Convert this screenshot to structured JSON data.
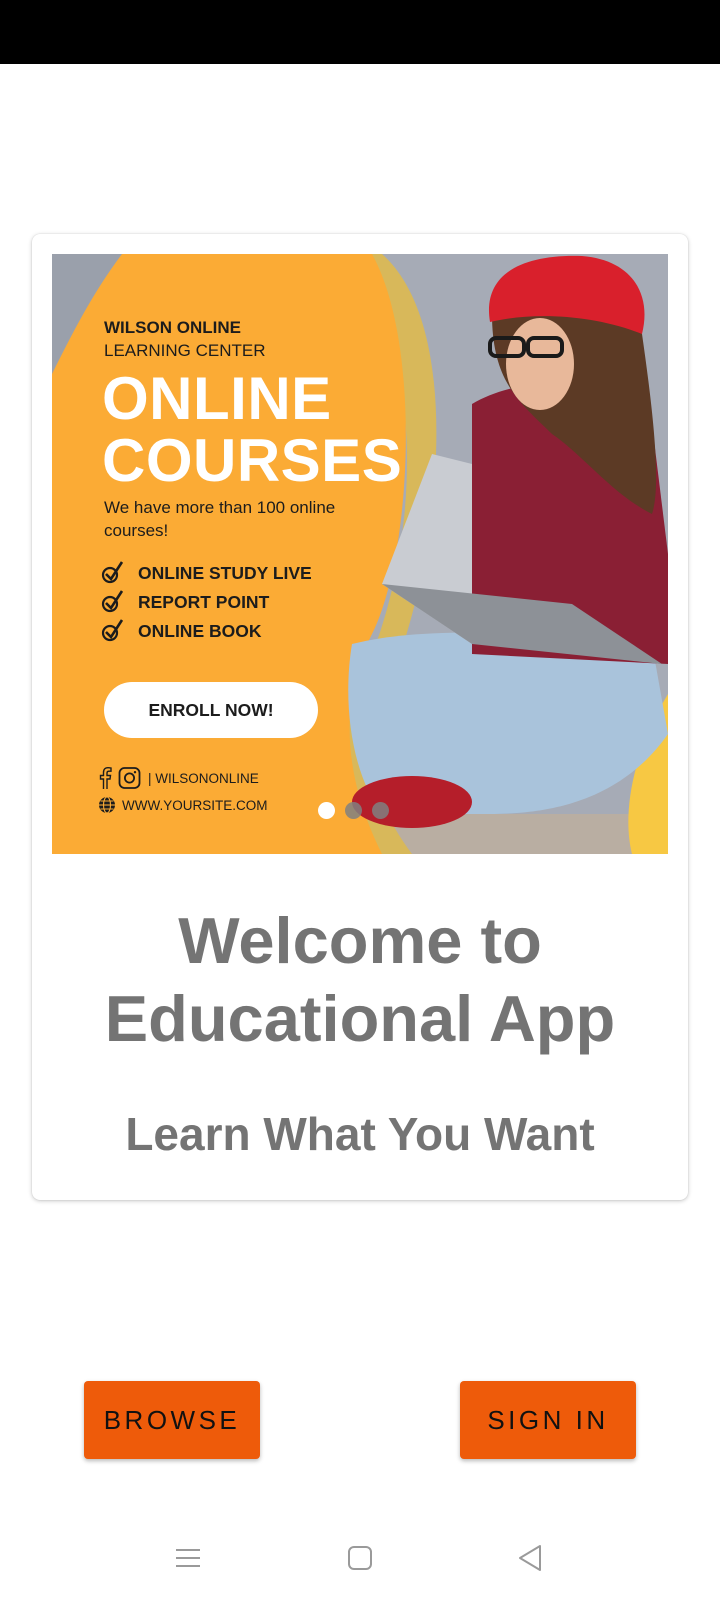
{
  "banner": {
    "brand_line1": "WILSON ONLINE",
    "brand_line2": "LEARNING CENTER",
    "headline_line1": "ONLINE",
    "headline_line2": "COURSES",
    "subcopy": "We have more than 100 online courses!",
    "features": [
      "ONLINE STUDY LIVE",
      "REPORT POINT",
      "ONLINE BOOK"
    ],
    "enroll_label": "ENROLL NOW!",
    "social_handle": "| WILSONONLINE",
    "website": "WWW.YOURSITE.COM",
    "icons": [
      "facebook-icon",
      "instagram-icon",
      "globe-icon",
      "check-icon"
    ],
    "accent_color": "#fbab35",
    "carousel": {
      "slide_count": 3,
      "active_slide": 1
    }
  },
  "welcome": {
    "title_line1": "Welcome to",
    "title_line2": "Educational App",
    "tagline": "Learn What You Want",
    "text_color": "#747474"
  },
  "actions": {
    "browse_label": "BROWSE",
    "signin_label": "SIGN IN",
    "button_color": "#ee5b0a"
  },
  "nav": {
    "icons": [
      "menu-icon",
      "home-icon",
      "back-icon"
    ]
  }
}
